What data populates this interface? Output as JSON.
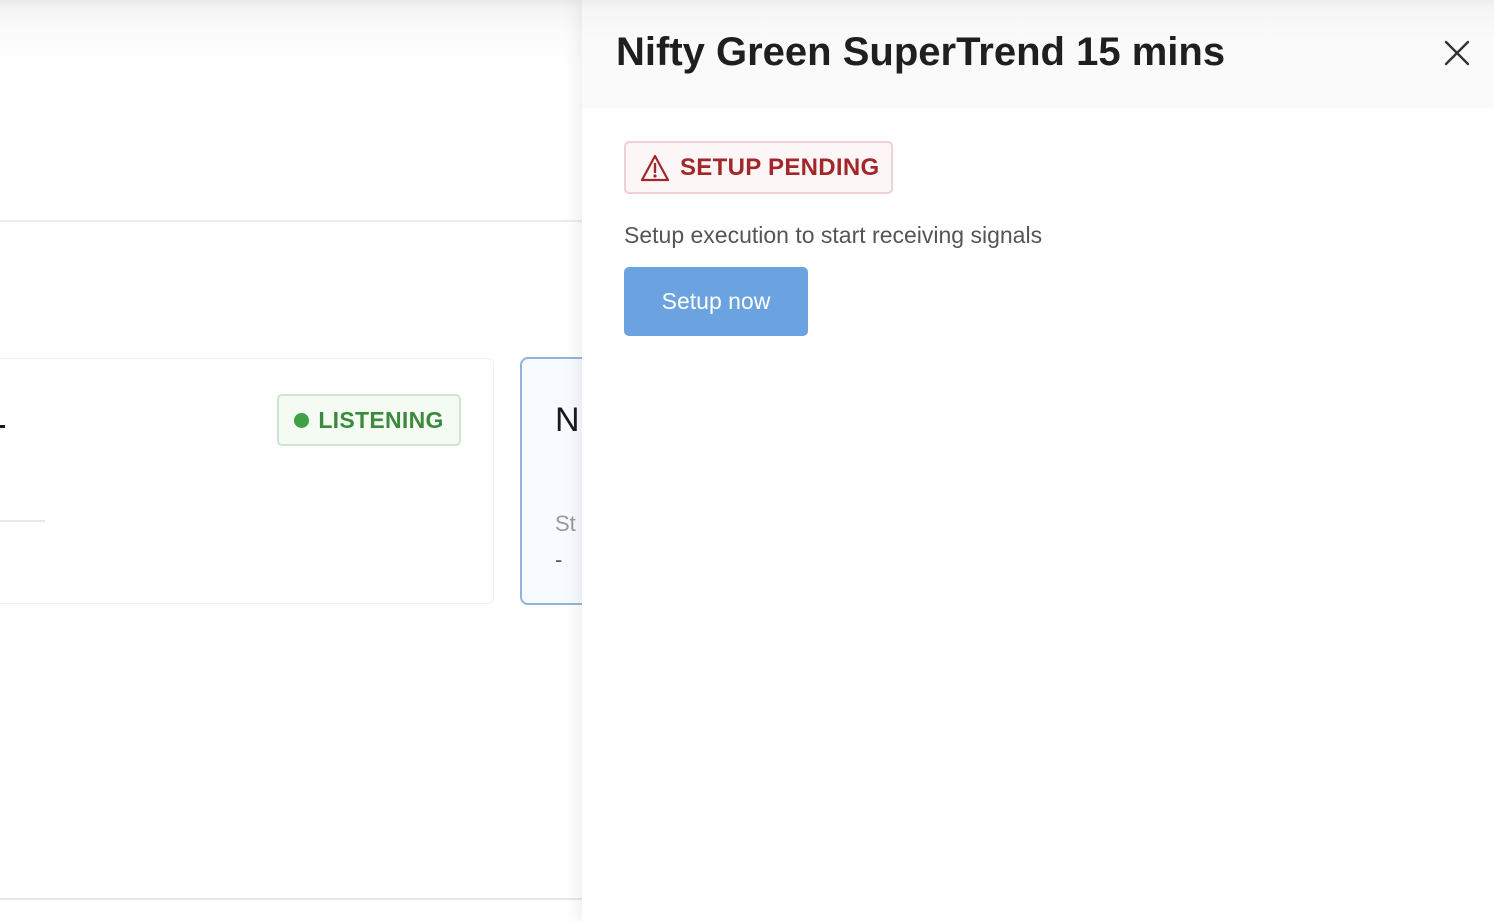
{
  "background": {
    "card_left": {
      "status_label": "LISTENING"
    },
    "card_right": {
      "title_fragment": "N",
      "label_fragment": "St",
      "value": "-"
    }
  },
  "drawer": {
    "title": "Nifty Green SuperTrend 15 mins",
    "close_icon": "close-icon",
    "status_badge": {
      "icon": "warning-triangle-icon",
      "label": "SETUP PENDING"
    },
    "helper_text": "Setup execution to start receiving signals",
    "setup_button_label": "Setup now"
  },
  "colors": {
    "listening_green": "#3d8a3f",
    "pending_red": "#a3262a",
    "primary_button": "#6aa3e0",
    "card_border_active": "#8fb4de"
  }
}
